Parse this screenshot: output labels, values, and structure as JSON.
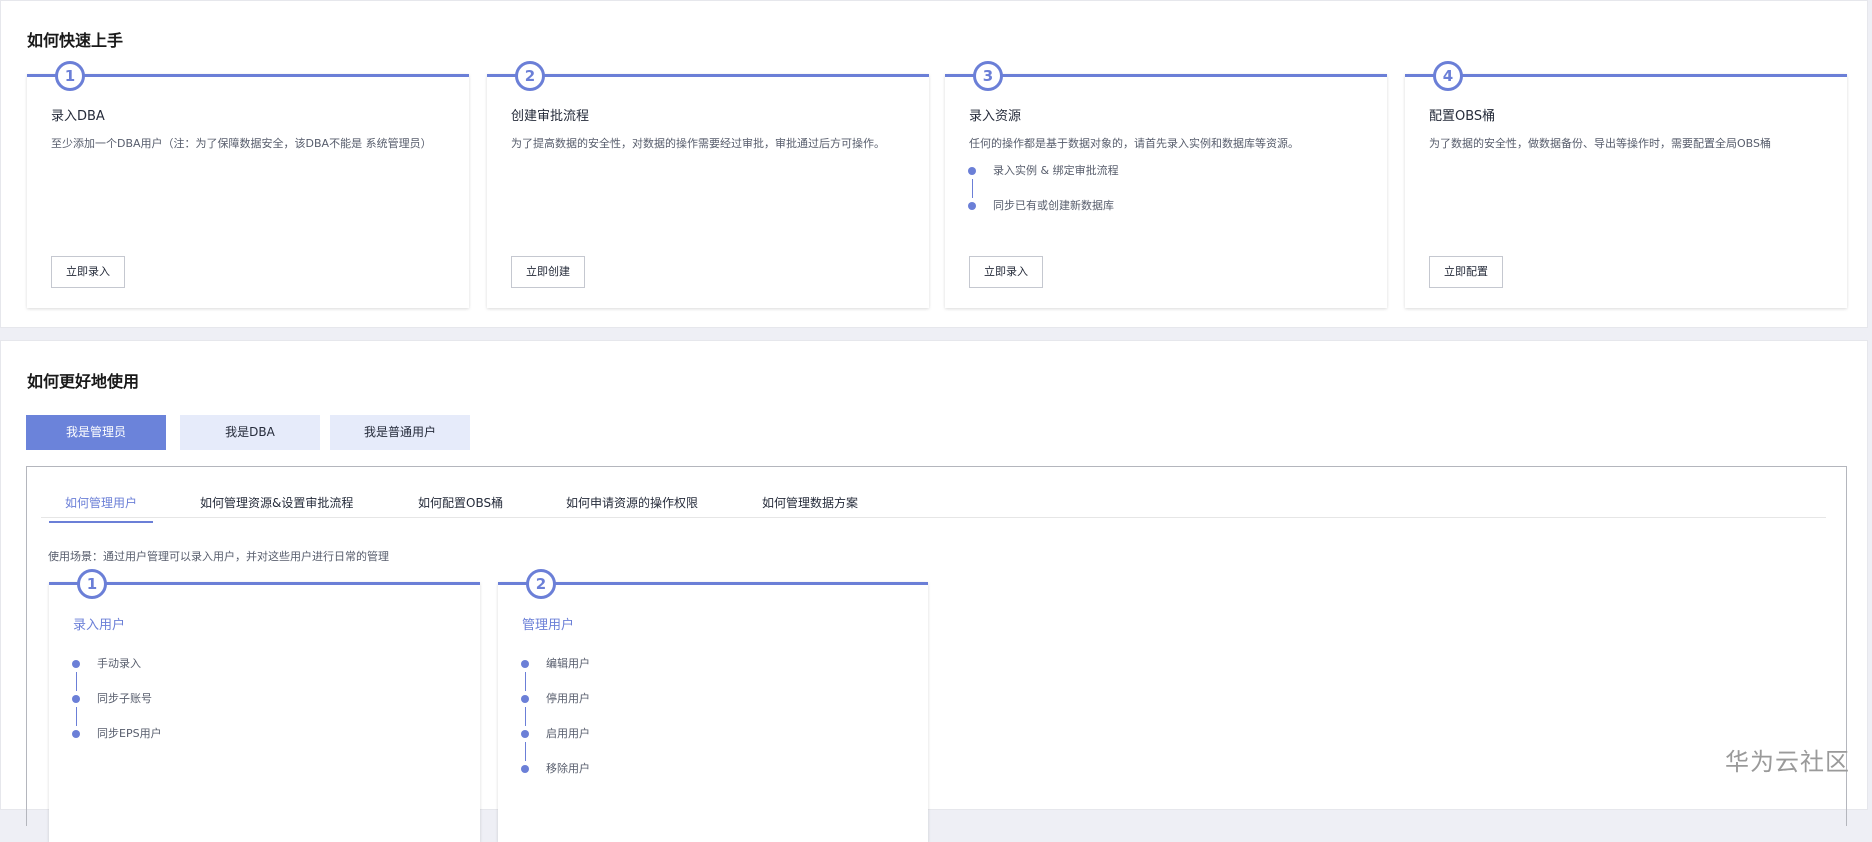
{
  "quick_start": {
    "title": "如何快速上手",
    "cards": [
      {
        "num": "1",
        "title": "录入DBA",
        "desc": "至少添加一个DBA用户（注：为了保障数据安全，该DBA不能是 系统管理员）",
        "button": "立即录入"
      },
      {
        "num": "2",
        "title": "创建审批流程",
        "desc": "为了提高数据的安全性，对数据的操作需要经过审批，审批通过后方可操作。",
        "button": "立即创建"
      },
      {
        "num": "3",
        "title": "录入资源",
        "desc": "任何的操作都是基于数据对象的，请首先录入实例和数据库等资源。",
        "steps": [
          "录入实例 & 绑定审批流程",
          "同步已有或创建新数据库"
        ],
        "button": "立即录入"
      },
      {
        "num": "4",
        "title": "配置OBS桶",
        "desc": "为了数据的安全性，做数据备份、导出等操作时，需要配置全局OBS桶",
        "button": "立即配置"
      }
    ]
  },
  "better_use": {
    "title": "如何更好地使用",
    "roles": [
      "我是管理员",
      "我是DBA",
      "我是普通用户"
    ],
    "tabs": [
      "如何管理用户",
      "如何管理资源&设置审批流程",
      "如何配置OBS桶",
      "如何申请资源的操作权限",
      "如何管理数据方案"
    ],
    "scenario": "使用场景：通过用户管理可以录入用户，并对这些用户进行日常的管理",
    "cards": [
      {
        "num": "1",
        "title": "录入用户",
        "steps": [
          "手动录入",
          "同步子账号",
          "同步EPS用户"
        ]
      },
      {
        "num": "2",
        "title": "管理用户",
        "steps": [
          "编辑用户",
          "停用用户",
          "启用用户",
          "移除用户"
        ]
      }
    ]
  },
  "watermark": "华为云社区",
  "accent": "#6b7fd7"
}
